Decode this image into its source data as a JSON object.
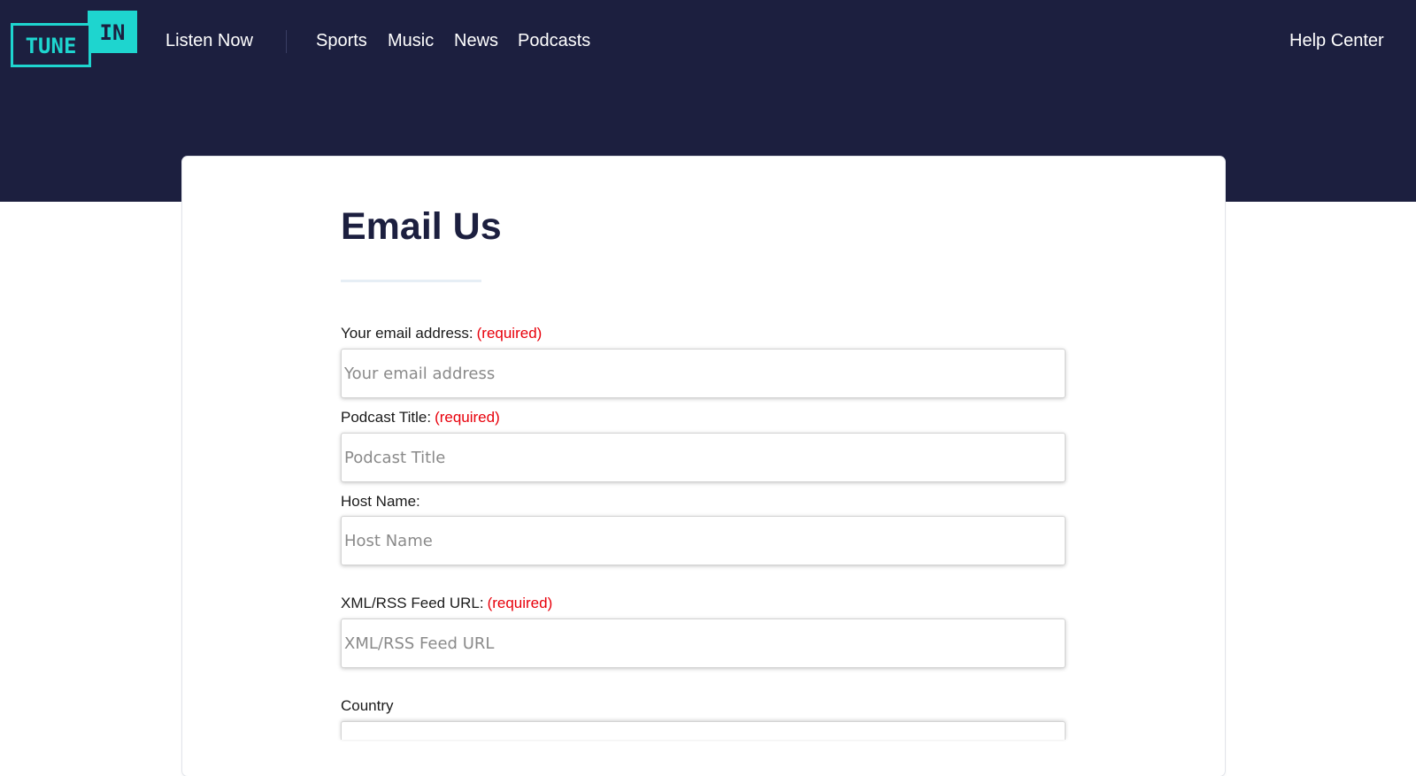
{
  "brand": {
    "logo_part1": "TUNE",
    "logo_part2": "IN",
    "accent_color": "#1ed5cf",
    "header_bg": "#1c1f3f"
  },
  "nav": {
    "listen_now": "Listen Now",
    "sports": "Sports",
    "music": "Music",
    "news": "News",
    "podcasts": "Podcasts",
    "help_center": "Help Center"
  },
  "form": {
    "title": "Email Us",
    "required_text": "(required)",
    "fields": {
      "email": {
        "label": "Your email address:",
        "placeholder": "Your email address",
        "value": ""
      },
      "podcast_title": {
        "label": "Podcast Title:",
        "placeholder": "Podcast Title",
        "value": ""
      },
      "host_name": {
        "label": "Host Name:",
        "placeholder": "Host Name",
        "value": ""
      },
      "rss_url": {
        "label": "XML/RSS Feed URL:",
        "placeholder": "XML/RSS Feed URL",
        "value": ""
      },
      "country": {
        "label": "Country",
        "placeholder": "",
        "value": ""
      }
    }
  }
}
